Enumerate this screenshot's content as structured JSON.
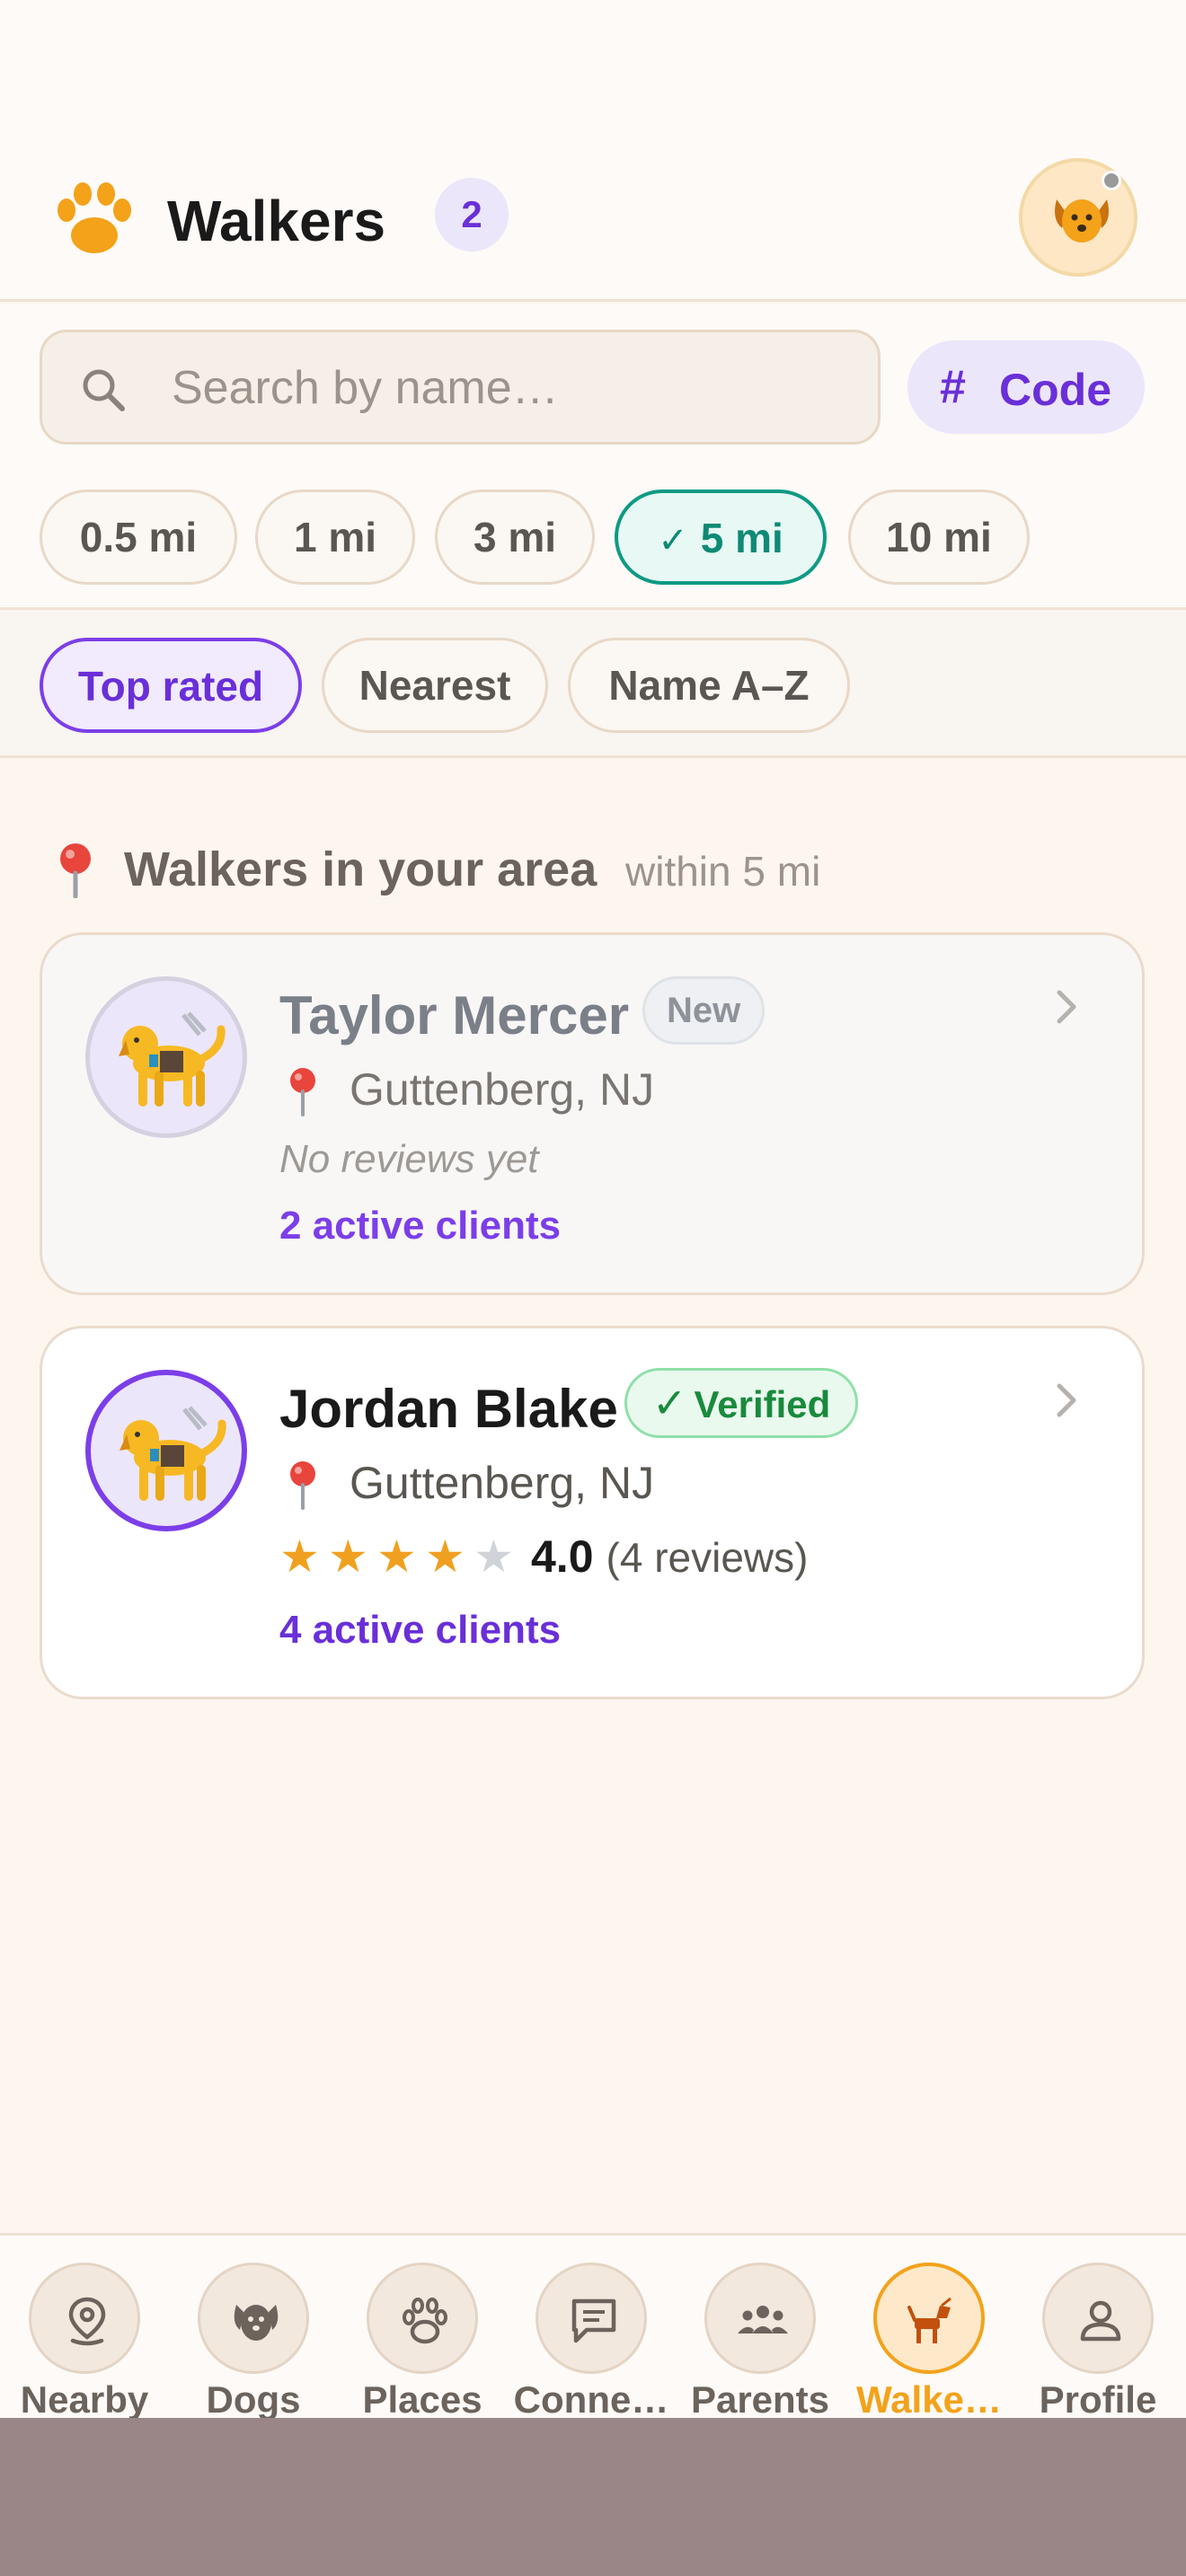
{
  "header": {
    "title": "Walkers",
    "count": "2",
    "brand_color": "#f3a21a",
    "accent_color": "#6a2fd8"
  },
  "search": {
    "placeholder": "Search by name…",
    "value": "",
    "code_label": "Code",
    "code_hash": "#"
  },
  "distance_filters": [
    {
      "label": "0.5 mi",
      "selected": false
    },
    {
      "label": "1 mi",
      "selected": false
    },
    {
      "label": "3 mi",
      "selected": false
    },
    {
      "label": "5 mi",
      "selected": true
    },
    {
      "label": "10 mi",
      "selected": false
    }
  ],
  "sort_options": [
    {
      "label": "Top rated",
      "selected": true
    },
    {
      "label": "Nearest",
      "selected": false
    },
    {
      "label": "Name A–Z",
      "selected": false
    }
  ],
  "section": {
    "title": "Walkers in your area",
    "subtitle": "within 5 mi"
  },
  "walkers": [
    {
      "name": "Taylor Mercer",
      "badge": "New",
      "location": "Guttenberg, NJ",
      "reviews_text": "No reviews yet",
      "clients": "2 active clients"
    },
    {
      "name": "Jordan Blake",
      "badge": "Verified",
      "badge_check": "✓",
      "location": "Guttenberg, NJ",
      "rating": "4.0",
      "rating_stars": 4,
      "reviews_text": "(4 reviews)",
      "clients": "4 active clients"
    }
  ],
  "bottom_nav": [
    {
      "label": "Nearby",
      "icon": "map-pin-icon",
      "active": false
    },
    {
      "label": "Dogs",
      "icon": "dog-face-icon",
      "active": false
    },
    {
      "label": "Places",
      "icon": "paw-icon",
      "active": false
    },
    {
      "label": "Conne…",
      "icon": "chat-icon",
      "active": false
    },
    {
      "label": "Parents",
      "icon": "group-icon",
      "active": false
    },
    {
      "label": "Walke…",
      "icon": "dog-walk-icon",
      "active": true
    },
    {
      "label": "Profile",
      "icon": "person-icon",
      "active": false
    }
  ]
}
